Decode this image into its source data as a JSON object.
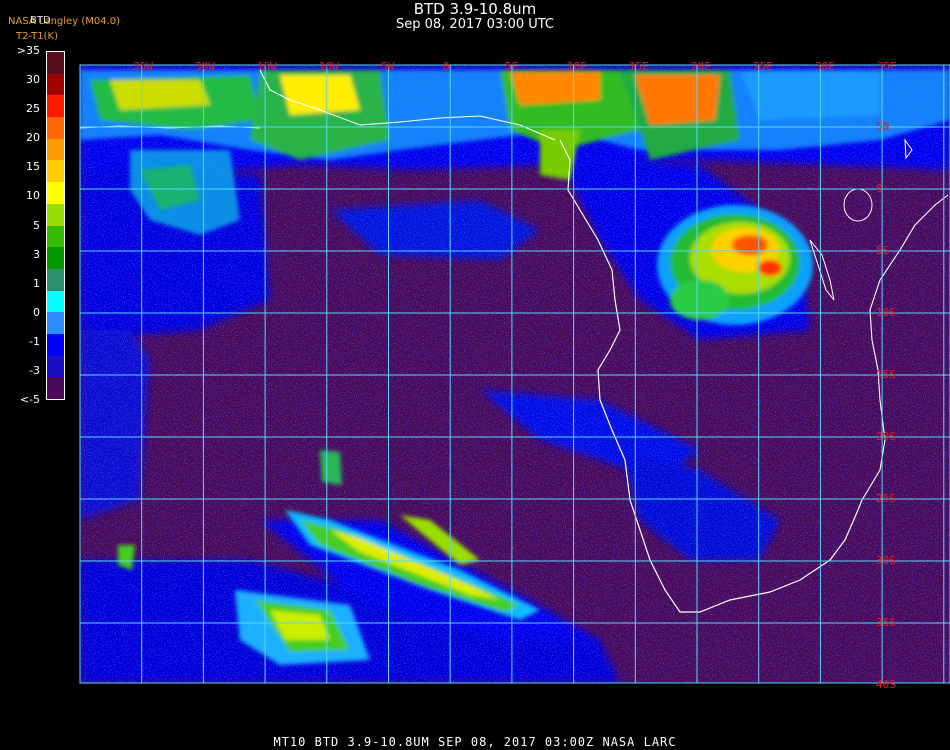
{
  "header": {
    "title": "BTD 3.9-10.8um",
    "subtitle": "Sep 08, 2017 03:00 UTC",
    "credit_line1": "NASA Langley (M04.0)",
    "credit_line2": "T2-T1(K)",
    "colorbar_label": "BTD"
  },
  "colorbar": {
    "ticks": [
      ">35",
      "30",
      "25",
      "20",
      "15",
      "10",
      "5",
      "3",
      "1",
      "0",
      "-1",
      "-3",
      "<-5"
    ],
    "colors": [
      "#5a0f1e",
      "#a00000",
      "#ff1a00",
      "#ff6600",
      "#ff9900",
      "#ffcc00",
      "#ffff00",
      "#99dd00",
      "#33bb00",
      "#009a00",
      "#2a8f6a",
      "#00ffff",
      "#2b8cff",
      "#0000ff",
      "#1c0dc8",
      "#4b0a5a"
    ]
  },
  "map": {
    "lat_labels": [
      "5N",
      "0",
      "5S",
      "10S",
      "15S",
      "20S",
      "25S",
      "30S",
      "35S",
      "40S"
    ],
    "lon_labels": [
      "35W",
      "30W",
      "15W",
      "10W",
      "5W",
      "0",
      "5E",
      "10E",
      "15E",
      "20E",
      "25E",
      "30E",
      "35E"
    ],
    "grid_color": "#55d8ff",
    "coast_color": "#ffffff"
  },
  "footer": {
    "text": "MT10  BTD 3.9-10.8UM   SEP 08, 2017 03:00Z   NASA LARC"
  }
}
